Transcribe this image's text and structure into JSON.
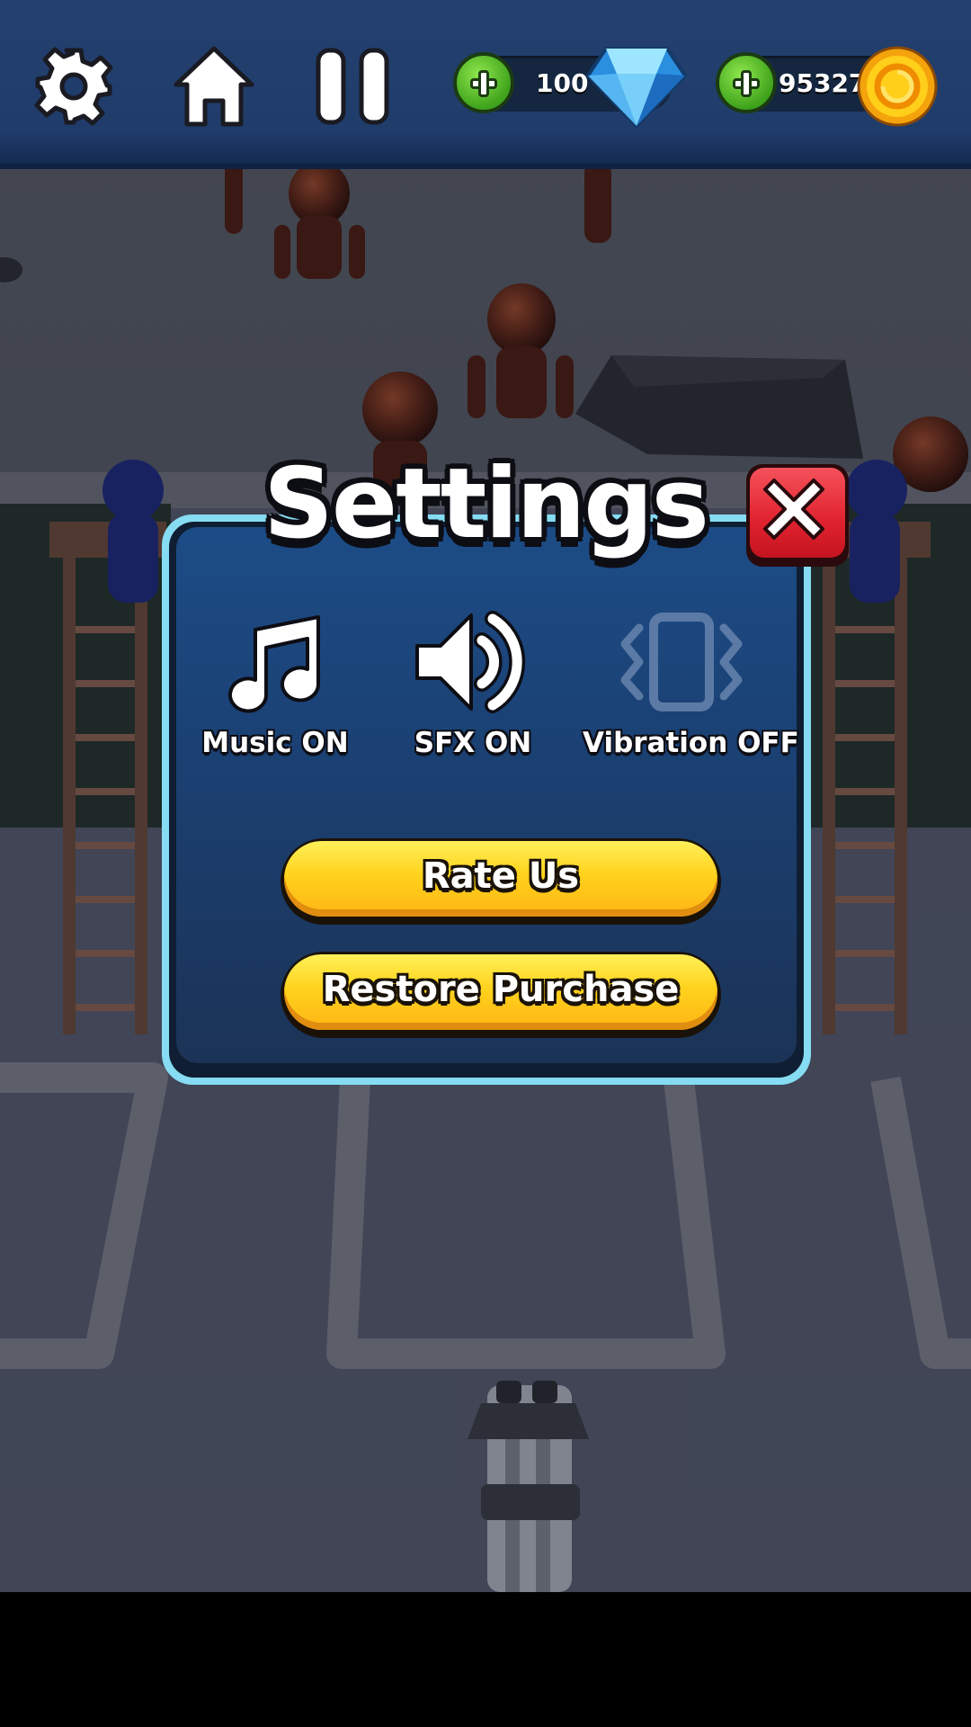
{
  "hud": {
    "gems": {
      "value": "100",
      "icon": "diamond-icon"
    },
    "coins": {
      "value": "95327",
      "icon": "coin-icon"
    }
  },
  "settings": {
    "title": "Settings",
    "toggles": [
      {
        "label": "Music ON",
        "icon": "music-note-icon",
        "state": "on"
      },
      {
        "label": "SFX ON",
        "icon": "speaker-icon",
        "state": "on"
      },
      {
        "label": "Vibration OFF",
        "icon": "vibration-icon",
        "state": "off"
      }
    ],
    "buttons": {
      "rate": "Rate Us",
      "restore": "Restore Purchase"
    }
  },
  "colors": {
    "hud_bg": "#1f3c6b",
    "panel_border": "#86dcf2",
    "panel_bg": "#1b4174",
    "button_yellow": "#ffd21c",
    "close_red": "#e0222f",
    "toggle_off": "#5b7aa6"
  }
}
